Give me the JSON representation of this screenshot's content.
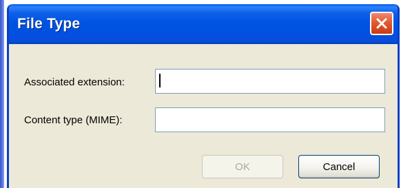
{
  "dialog": {
    "title": "File Type",
    "close_icon": "close-icon"
  },
  "form": {
    "extension_label": "Associated extension:",
    "extension_value": "",
    "mime_label": "Content type (MIME):",
    "mime_value": ""
  },
  "buttons": {
    "ok_label": "OK",
    "ok_enabled": false,
    "cancel_label": "Cancel"
  },
  "colors": {
    "titlebar": "#0054e3",
    "close_button": "#e25a30",
    "dialog_background": "#ece9d8"
  }
}
